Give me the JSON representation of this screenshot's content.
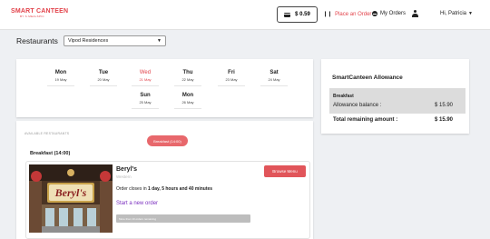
{
  "header": {
    "logo_main": "SMART CANTEEN",
    "logo_sub": "BY S·MEALSPIC",
    "balance": "$ 0.59",
    "place_order": "Place an Order",
    "my_orders": "My Orders",
    "greeting": "Hi, Patricia"
  },
  "filter": {
    "label": "Restaurants",
    "selected": "Vipod Residences"
  },
  "days": [
    {
      "name": "Mon",
      "date": "19 May"
    },
    {
      "name": "Tue",
      "date": "20 May"
    },
    {
      "name": "Wed",
      "date": "21 May",
      "active": true
    },
    {
      "name": "Thu",
      "date": "22 May"
    },
    {
      "name": "Fri",
      "date": "23 May"
    },
    {
      "name": "Sat",
      "date": "24 May"
    },
    {
      "name": "Sun",
      "date": "25 May"
    },
    {
      "name": "Mon",
      "date": "26 May"
    }
  ],
  "restaurants_section": {
    "available_label": "AVAILABLE RESTAURANTS",
    "meal_pill": "Breakfast (14:00)",
    "section_title": "Breakfast   (14:00)"
  },
  "restaurant": {
    "name": "Beryl's",
    "cuisine": "Western",
    "closes_prefix": "Order closes in ",
    "closes_time": "1 day, 5 hours and 40 minutes",
    "start_order": "Start a new order",
    "progress_text": "More than 10 orders remaining",
    "browse_label": "Browse Menu",
    "image_sign": "Beryl's"
  },
  "allowance": {
    "title": "SmartCanteen Allowance",
    "meal": "Breakfast",
    "balance_label": "Allowance balance :",
    "balance_value": "$ 15.90",
    "total_label": "Total remaining amount :",
    "total_value": "$ 15.90"
  },
  "colors": {
    "accent": "#e2424a",
    "link": "#7b2fbf"
  }
}
